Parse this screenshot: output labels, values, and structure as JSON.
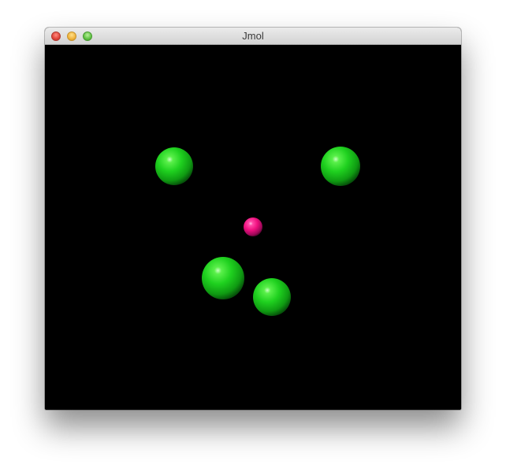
{
  "window": {
    "title": "Jmol",
    "controls": {
      "close_icon": "close-icon",
      "minimize_icon": "minimize-icon",
      "zoom_icon": "zoom-icon"
    }
  },
  "viewer": {
    "background_color": "#000000",
    "atom_colors": {
      "green": "#1fd11f",
      "magenta": "#ff1493"
    },
    "atoms": [
      {
        "name": "atom-green-1",
        "color": "green"
      },
      {
        "name": "atom-green-2",
        "color": "green"
      },
      {
        "name": "atom-magenta-center",
        "color": "magenta"
      },
      {
        "name": "atom-green-3",
        "color": "green"
      },
      {
        "name": "atom-green-4",
        "color": "green"
      }
    ]
  }
}
